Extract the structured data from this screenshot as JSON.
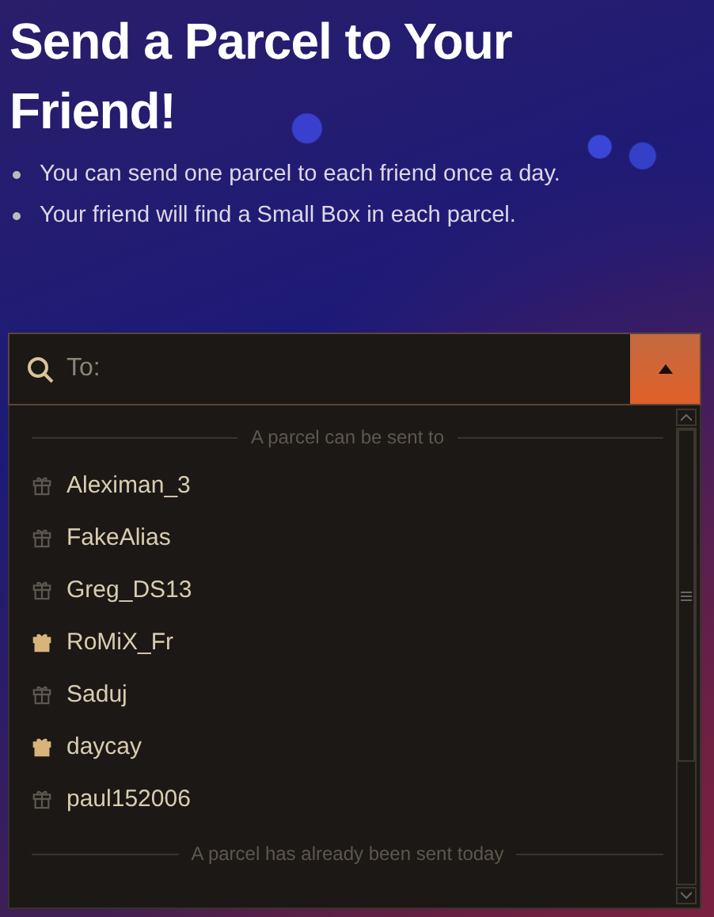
{
  "title": "Send a Parcel to Your Friend!",
  "bullets": [
    "You can send one parcel to each friend once a day.",
    "Your friend will find a Small Box in each parcel."
  ],
  "search": {
    "placeholder": "To:",
    "expanded": true
  },
  "sections": [
    {
      "heading": "A parcel can be sent to",
      "friends": [
        {
          "name": "Aleximan_3",
          "highlighted": false
        },
        {
          "name": "FakeAlias",
          "highlighted": false
        },
        {
          "name": "Greg_DS13",
          "highlighted": false
        },
        {
          "name": "RoMiX_Fr",
          "highlighted": true
        },
        {
          "name": "Saduj",
          "highlighted": false
        },
        {
          "name": "daycay",
          "highlighted": true
        },
        {
          "name": "paul152006",
          "highlighted": false
        }
      ]
    },
    {
      "heading": "A parcel has already been sent today"
    }
  ]
}
